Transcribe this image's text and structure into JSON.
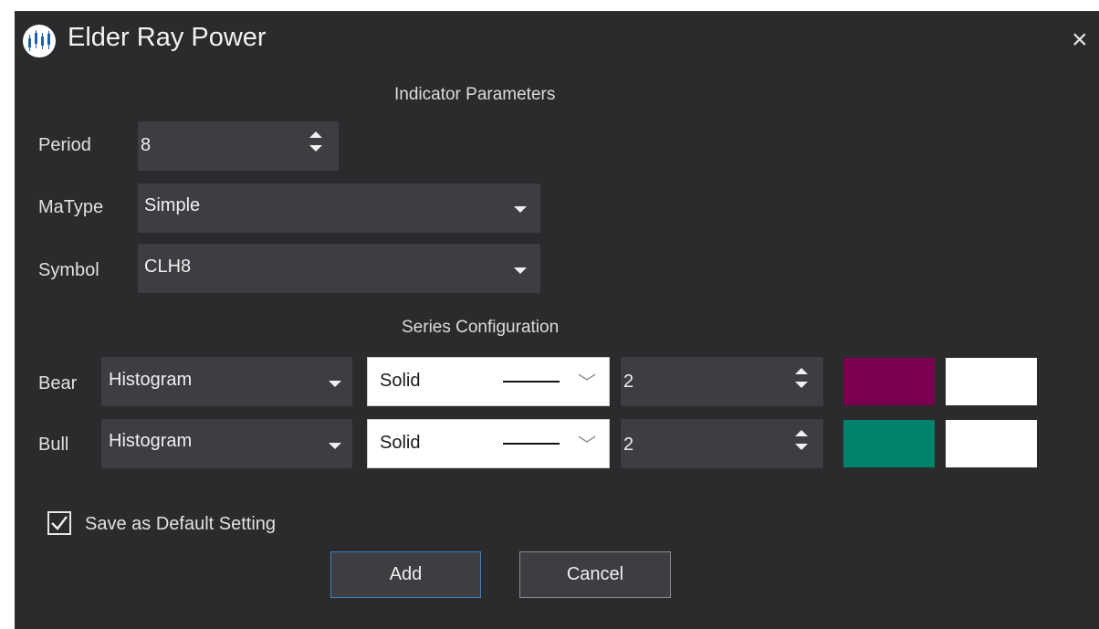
{
  "dialog": {
    "title": "Elder Ray Power",
    "close_symbol": "×",
    "app_icon": "chart-logo-icon"
  },
  "indicator_parameters": {
    "heading": "Indicator Parameters",
    "period": {
      "label": "Period",
      "value": "8"
    },
    "matype": {
      "label": "MaType",
      "value": "Simple"
    },
    "symbol": {
      "label": "Symbol",
      "value": "CLH8"
    }
  },
  "series_configuration": {
    "heading": "Series Configuration",
    "rows": [
      {
        "label": "Bear",
        "type": "Histogram",
        "line_style": "Solid",
        "width": "2",
        "color": "#7b0050",
        "secondary_color": "#ffffff"
      },
      {
        "label": "Bull",
        "type": "Histogram",
        "line_style": "Solid",
        "width": "2",
        "color": "#00826b",
        "secondary_color": "#ffffff"
      }
    ]
  },
  "footer": {
    "save_default_label": "Save as Default Setting",
    "save_default_checked": true,
    "add_label": "Add",
    "cancel_label": "Cancel"
  },
  "colors": {
    "dialog_bg": "#2b2b2e",
    "field_bg": "#3d3d42",
    "accent": "#3a7fc0"
  }
}
